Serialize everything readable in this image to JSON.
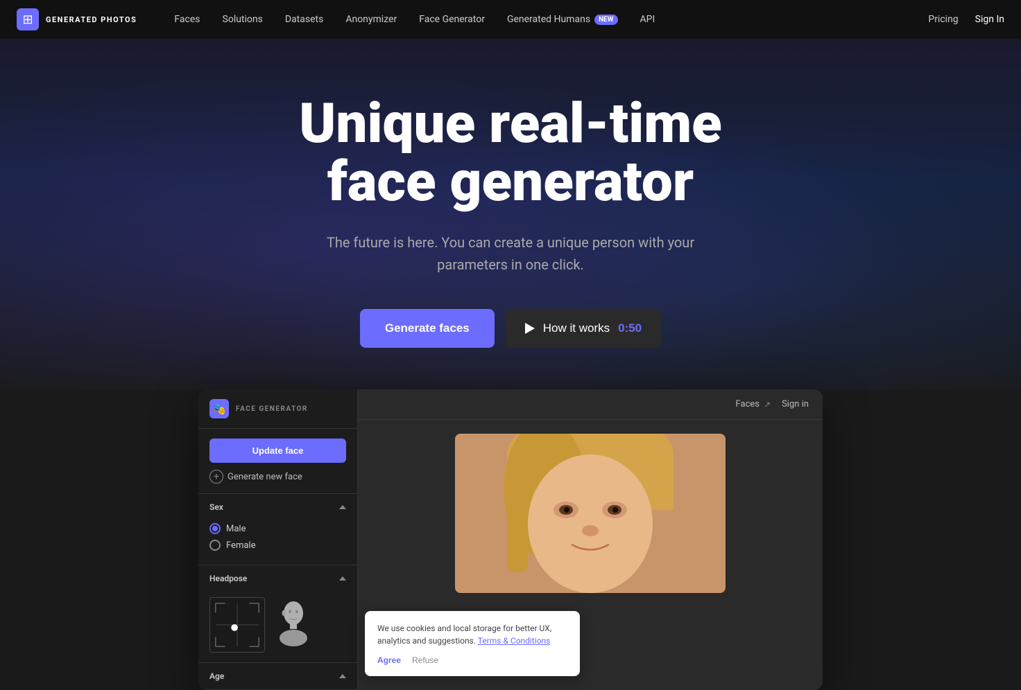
{
  "nav": {
    "logo_text": "GENERATED PHOTOS",
    "links": [
      {
        "label": "Faces",
        "badge": null
      },
      {
        "label": "Solutions",
        "badge": null
      },
      {
        "label": "Datasets",
        "badge": null
      },
      {
        "label": "Anonymizer",
        "badge": null
      },
      {
        "label": "Face Generator",
        "badge": null
      },
      {
        "label": "Generated Humans",
        "badge": "New"
      },
      {
        "label": "API",
        "badge": null
      }
    ],
    "pricing": "Pricing",
    "signin": "Sign In"
  },
  "hero": {
    "title": "Unique real-time face generator",
    "subtitle": "The future is here. You can create a unique person with your parameters in one click.",
    "generate_button": "Generate faces",
    "how_button": "How it works",
    "how_time": "0:50"
  },
  "preview": {
    "sidebar": {
      "header_icon": "🎭",
      "header_title": "FACE GENERATOR",
      "update_button": "Update face",
      "generate_new": "Generate new face",
      "sex_label": "Sex",
      "sex_options": [
        {
          "label": "Male",
          "selected": true
        },
        {
          "label": "Female",
          "selected": false
        }
      ],
      "headpose_label": "Headpose",
      "age_label": "Age"
    },
    "main": {
      "faces_link": "Faces",
      "signin_link": "Sign in"
    }
  },
  "cookie": {
    "text": "We use cookies and local storage for better UX, analytics and suggestions.",
    "link_text": "Terms & Conditions",
    "agree": "Agree",
    "refuse": "Refuse"
  }
}
